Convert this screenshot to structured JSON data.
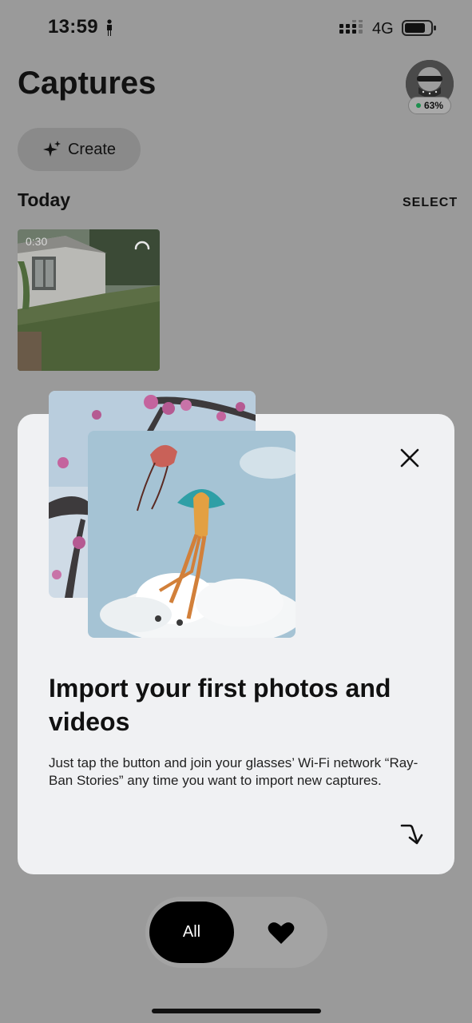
{
  "status_bar": {
    "time": "13:59",
    "network": "4G"
  },
  "header": {
    "title": "Captures",
    "device_battery": "63%"
  },
  "toolbar": {
    "create_label": "Create"
  },
  "section": {
    "title": "Today",
    "select_label": "SELECT"
  },
  "capture": {
    "duration": "0:30"
  },
  "import_sheet": {
    "title": "Import your first photos and videos",
    "body": "Just tap the button and join your glasses’ Wi-Fi network “Ray-Ban Stories” any time you want to import new captures."
  },
  "filter": {
    "all_label": "All"
  },
  "colors": {
    "accent_green": "#1c8f4e",
    "sheet_bg": "#f0f1f3",
    "dim_bg": "#9a9a9a"
  },
  "icons": [
    "person-icon",
    "signal-icon",
    "battery-icon",
    "sparkle-icon",
    "close-icon",
    "arrow-down-right-icon",
    "heart-icon"
  ]
}
